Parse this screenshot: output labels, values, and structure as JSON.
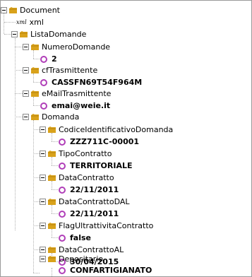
{
  "tree": {
    "root": {
      "label": "Document",
      "icon": "folder-icon"
    },
    "xml_node": {
      "badge": "xml",
      "label": "xml"
    },
    "lista_domande": {
      "label": "ListaDomande"
    },
    "numero_domande": {
      "label": "NumeroDomande",
      "value": "2"
    },
    "cf_trasmittente": {
      "label": "cfTrasmittente",
      "value": "CASSFN69T54F964M"
    },
    "email_trasmittente": {
      "label": "eMailTrasmittente",
      "value": "emai@weie.it"
    },
    "domanda": {
      "label": "Domanda"
    },
    "codice_identificativo": {
      "label": "CodiceIdentificativoDomanda",
      "value": "ZZZ711C-00001"
    },
    "tipo_contratto": {
      "label": "TipoContratto",
      "value": "TERRITORIALE"
    },
    "data_contratto": {
      "label": "DataContratto",
      "value": "22/11/2011"
    },
    "data_contratto_dal": {
      "label": "DataContrattoDAL",
      "value": "22/11/2011"
    },
    "flag_ultrattivita": {
      "label": "FlagUltrattivitaContratto",
      "value": "false"
    },
    "data_contratto_al": {
      "label": "DataContrattoAL",
      "value": "30/04/2015"
    },
    "depositario": {
      "label": "Depositario",
      "value": "CONFARTIGIANATO"
    }
  },
  "colors": {
    "folder": "#d9a21b",
    "value_circle": "#b03eb8",
    "connector": "#b0b0b0",
    "border": "#9a9a9a"
  }
}
